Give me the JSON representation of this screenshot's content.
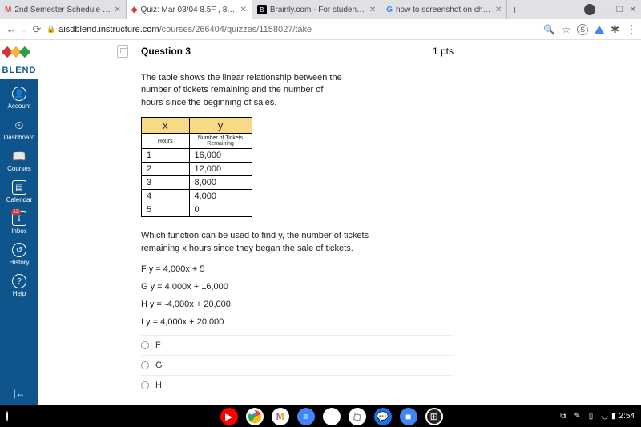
{
  "tabs": [
    {
      "title": "2nd Semester Schedule - brand",
      "icon_color": "#d14836"
    },
    {
      "title": "Quiz: Mar 03/04 8.5F , 8.5I Slop",
      "icon_color": "#e23838",
      "active": true
    },
    {
      "title": "Brainly.com - For students. By s",
      "icon_color": "#000"
    },
    {
      "title": "how to screenshot on chromeb",
      "icon_color": "#4285f4"
    }
  ],
  "url": {
    "prefix": "aisdblend.instructure.com",
    "path": "/courses/266404/quizzes/1158027/take"
  },
  "sidebar": {
    "brand": "BLEND",
    "items": [
      {
        "label": "Account"
      },
      {
        "label": "Dashboard"
      },
      {
        "label": "Courses"
      },
      {
        "label": "Calendar"
      },
      {
        "label": "Inbox",
        "badge": "13"
      },
      {
        "label": "History"
      },
      {
        "label": "Help"
      }
    ]
  },
  "question": {
    "header": "Question 3",
    "points": "1 pts",
    "intro": [
      "The table shows the linear relationship between the",
      "number of tickets remaining and the number of",
      "hours since the beginning of sales."
    ],
    "table": {
      "col_x": "x",
      "col_y": "y",
      "hx": "Hours",
      "hy": "Number of Tickets Remaining",
      "rows": [
        {
          "x": "1",
          "y": "16,000"
        },
        {
          "x": "2",
          "y": "12,000"
        },
        {
          "x": "3",
          "y": "8,000"
        },
        {
          "x": "4",
          "y": "4,000"
        },
        {
          "x": "5",
          "y": "0"
        }
      ]
    },
    "q2a": "Which function can be used to find y, the number of tickets",
    "q2b": "remaining x hours since they began the sale of tickets.",
    "options": [
      "F   y = 4,000x + 5",
      "G   y = 4,000x + 16,000",
      "H   y = -4,000x  + 20,000",
      "I    y = 4,000x + 20,000"
    ],
    "answers": [
      "F",
      "G",
      "H"
    ]
  },
  "chart_data": {
    "type": "table",
    "columns": [
      "Hours",
      "Number of Tickets Remaining"
    ],
    "rows": [
      [
        1,
        16000
      ],
      [
        2,
        12000
      ],
      [
        3,
        8000
      ],
      [
        4,
        4000
      ],
      [
        5,
        0
      ]
    ]
  },
  "shelf": {
    "time": "2:54"
  }
}
